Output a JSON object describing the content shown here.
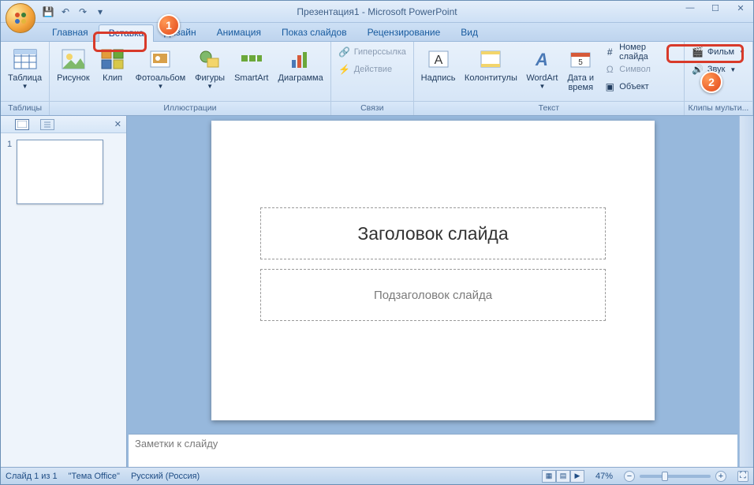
{
  "title": "Презентация1 - Microsoft PowerPoint",
  "qat": {
    "save": "💾",
    "undo": "↶",
    "redo": "↷",
    "more": "▾"
  },
  "tabs": [
    "Главная",
    "Вставка",
    "Дизайн",
    "Анимация",
    "Показ слайдов",
    "Рецензирование",
    "Вид"
  ],
  "active_tab": 1,
  "ribbon": {
    "tables": {
      "label": "Таблицы",
      "table": "Таблица"
    },
    "illus": {
      "label": "Иллюстрации",
      "picture": "Рисунок",
      "clip": "Клип",
      "album": "Фотоальбом",
      "shapes": "Фигуры",
      "smartart": "SmartArt",
      "chart": "Диаграмма"
    },
    "links": {
      "label": "Связи",
      "hyperlink": "Гиперссылка",
      "action": "Действие"
    },
    "text": {
      "label": "Текст",
      "textbox": "Надпись",
      "headerfooter": "Колонтитулы",
      "wordart": "WordArt",
      "datetime": "Дата и\nвремя",
      "slidenum": "Номер слайда",
      "symbol": "Символ",
      "object": "Объект"
    },
    "media": {
      "label": "Клипы мульти...",
      "movie": "Фильм",
      "sound": "Звук"
    }
  },
  "callouts": {
    "one": "1",
    "two": "2"
  },
  "panel": {
    "thumb_num": "1"
  },
  "slide": {
    "title_ph": "Заголовок слайда",
    "subtitle_ph": "Подзаголовок слайда"
  },
  "notes": {
    "placeholder": "Заметки к слайду"
  },
  "status": {
    "slide": "Слайд 1 из 1",
    "theme": "\"Тема Office\"",
    "lang": "Русский (Россия)",
    "zoom": "47%"
  }
}
